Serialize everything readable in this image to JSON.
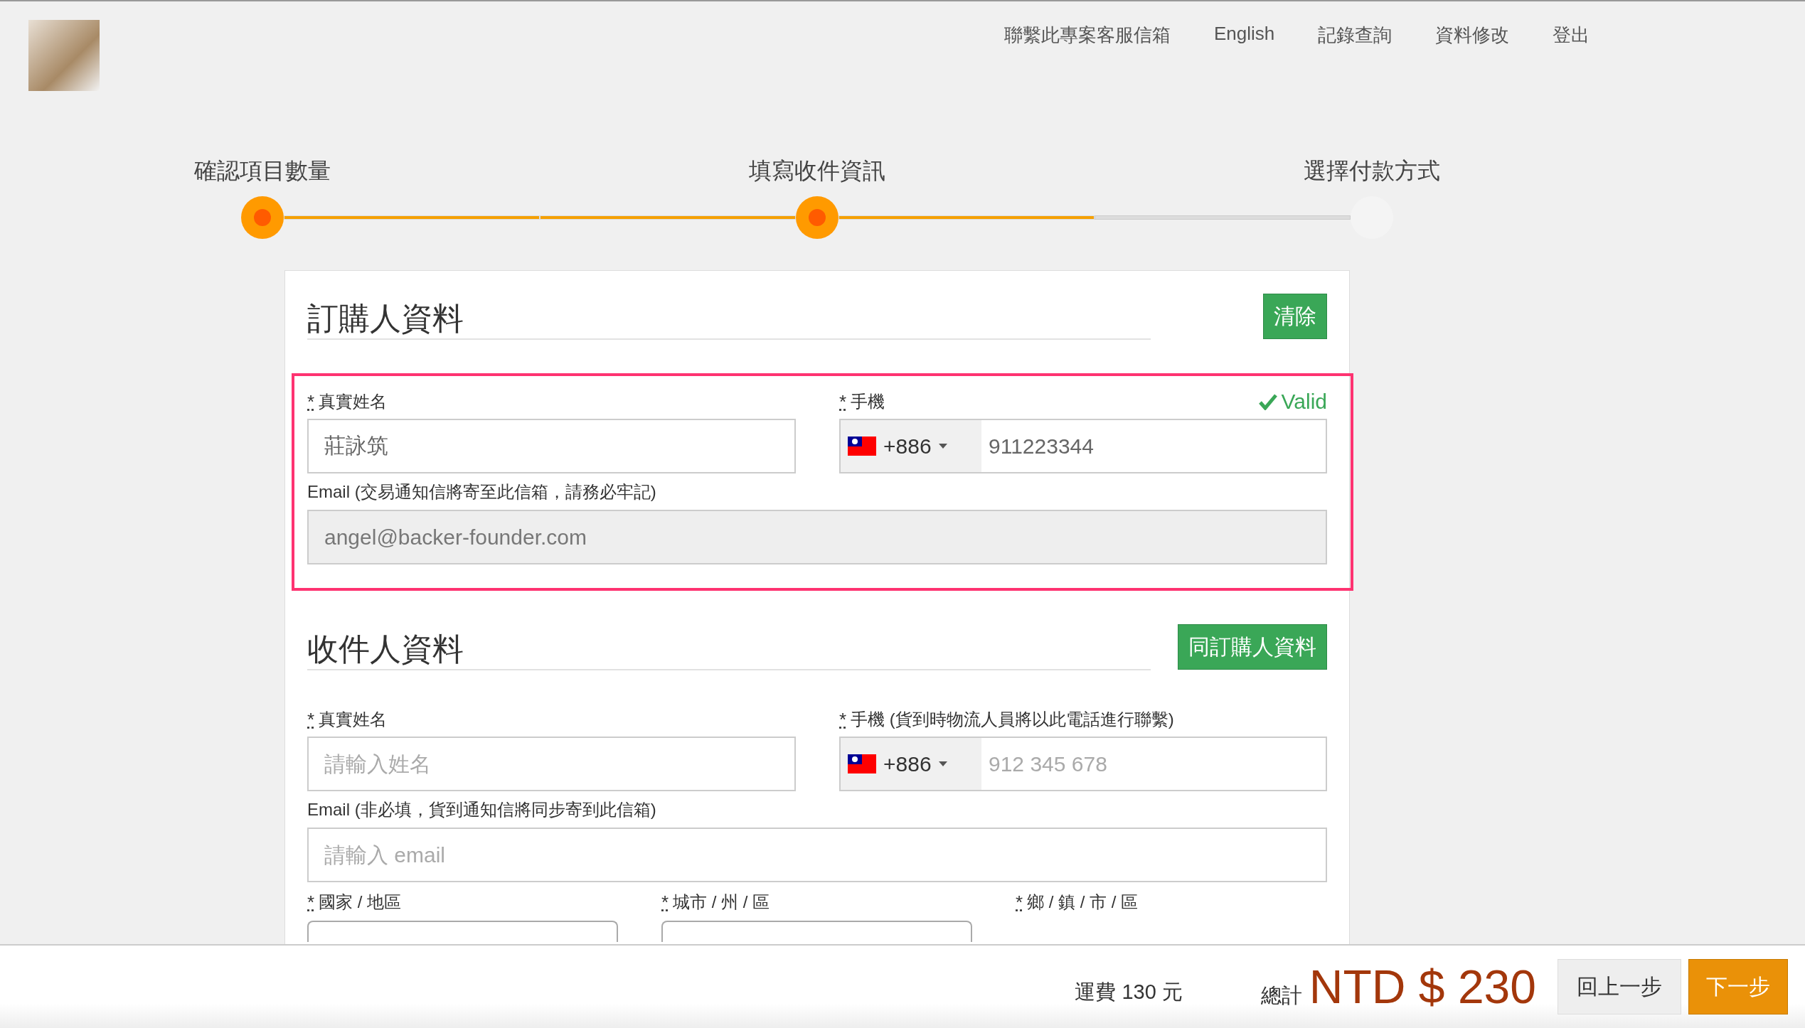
{
  "nav": {
    "links": [
      "聯繫此專案客服信箱",
      "English",
      "記錄查詢",
      "資料修改",
      "登出"
    ]
  },
  "steps": [
    {
      "label": "確認項目數量",
      "reached": true
    },
    {
      "label": "填寫收件資訊",
      "reached": true
    },
    {
      "label": "選擇付款方式",
      "reached": false
    }
  ],
  "buyer": {
    "title": "訂購人資料",
    "button": "清除",
    "highlighted": true,
    "validation": "Valid",
    "name": {
      "required_mark": "*",
      "label": "真實姓名",
      "value": "莊詠筑"
    },
    "phone": {
      "required_mark": "*",
      "label": "手機",
      "country_code": "+886",
      "value": "911223344"
    },
    "email": {
      "label": "Email (交易通知信將寄至此信箱，請務必牢記)",
      "value": "angel@backer-founder.com",
      "disabled": true
    }
  },
  "recipient": {
    "title": "收件人資料",
    "button": "同訂購人資料",
    "highlighted": false,
    "name": {
      "required_mark": "*",
      "label": "真實姓名",
      "placeholder": "請輸入姓名"
    },
    "phone": {
      "required_mark": "*",
      "label": "手機 (貨到時物流人員將以此電話進行聯繫)",
      "country_code": "+886",
      "placeholder": "912 345 678"
    },
    "email": {
      "label": "Email (非必填，貨到通知信將同步寄到此信箱)",
      "placeholder": "請輸入 email",
      "disabled": false
    },
    "region": [
      {
        "required_mark": "*",
        "label": "國家 / 地區",
        "select": true
      },
      {
        "required_mark": "*",
        "label": "城市 / 州 / 區",
        "select": true
      },
      {
        "required_mark": "*",
        "label": "鄉 / 鎮 / 市 / 區",
        "select": false
      }
    ]
  },
  "footer": {
    "shipping": "運費 130 元",
    "total_label": "總計",
    "total": "NTD $ 230",
    "back_button": "回上一步",
    "next_button": "下一步"
  }
}
